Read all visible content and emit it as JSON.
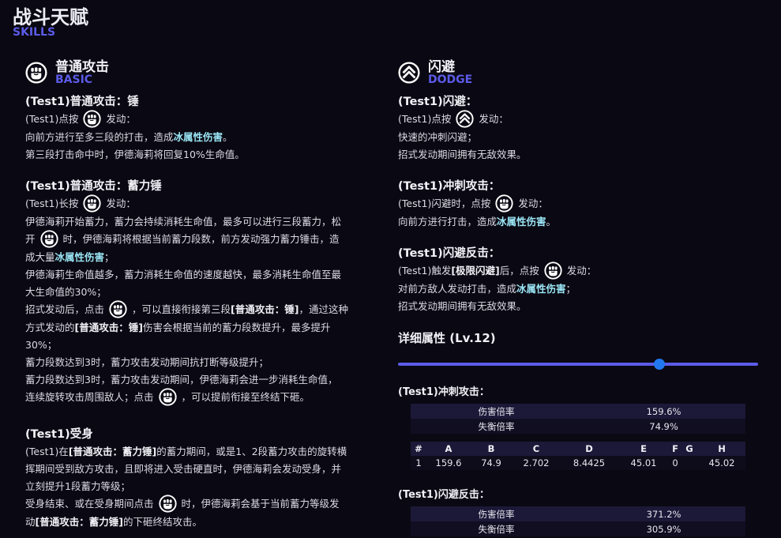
{
  "header": {
    "title": "战斗天赋",
    "subtitle": "SKILLS"
  },
  "basic": {
    "title": "普通攻击",
    "subtitle": "BASIC",
    "icon": "fist-icon",
    "b1": {
      "title": "(Test1)普通攻击：锤",
      "l1a": "(Test1)点按",
      "l1b": "发动：",
      "l2a": "向前方进行至多三段的打击，造成",
      "l2b": "冰属性伤害",
      "l2c": "。",
      "l3": "第三段打击命中时，伊德海莉将回复10%生命值。"
    },
    "b2": {
      "title": "(Test1)普通攻击：蓄力锤",
      "l1a": "(Test1)长按",
      "l1b": "发动：",
      "l2": "伊德海莉开始蓄力，蓄力会持续消耗生命值，最多可以进行三段蓄力，松",
      "l3a": "开",
      "l3b": "时，伊德海莉将根据当前蓄力段数，前方发动强力蓄力锤击，造",
      "l4a": "成大量",
      "l4b": "冰属性伤害",
      "l4c": "；",
      "l5": "伊德海莉生命值越多，蓄力消耗生命值的速度越快，最多消耗生命值至最",
      "l6": "大生命值的30%；",
      "l7a": "招式发动后，点击",
      "l7b": "，可以直接衔接第三段",
      "l7c": "[普通攻击：锤]",
      "l7d": "，通过这种",
      "l8a": "方式发动的",
      "l8b": "[普通攻击：锤]",
      "l8c": "伤害会根据当前的蓄力段数提升，最多提升",
      "l9": "30%；",
      "l10": "蓄力段数达到3时，蓄力攻击发动期间抗打断等级提升；",
      "l11": "蓄力段数达到3时，蓄力攻击发动期间，伊德海莉会进一步消耗生命值，",
      "l12a": "连续旋转攻击周围敌人；点击",
      "l12b": "，可以提前衔接至终结下砸。"
    },
    "b3": {
      "title": "(Test1)受身",
      "l1a": "(Test1)在",
      "l1b": "[普通攻击：蓄力锤]",
      "l1c": "的蓄力期间，或是1、2段蓄力攻击的旋转横",
      "l2": "挥期间受到敌方攻击，且即将进入受击硬直时，伊德海莉会发动受身，并",
      "l3": "立刻提升1段蓄力等级；",
      "l4a": "受身结束、或在受身期间点击",
      "l4b": "时，伊德海莉会基于当前蓄力等级发",
      "l5a": "动",
      "l5b": "[普通攻击：蓄力锤]",
      "l5c": "的下砸终结攻击。"
    }
  },
  "dodge": {
    "title": "闪避",
    "subtitle": "DODGE",
    "icon": "chevrons-up-icon",
    "b1": {
      "title": "(Test1)闪避：",
      "l1a": "(Test1)点按",
      "l1b": "发动：",
      "l2": "快速的冲刺闪避；",
      "l3": "招式发动期间拥有无敌效果。"
    },
    "b2": {
      "title": "(Test1)冲刺攻击：",
      "l1a": "(Test1)闪避时，点按",
      "l1b": "发动：",
      "l2a": "向前方进行打击，造成",
      "l2b": "冰属性伤害",
      "l2c": "。"
    },
    "b3": {
      "title": "(Test1)闪避反击：",
      "l1a": "(Test1)触发",
      "l1b": "[极限闪避]",
      "l1c": "后，点按",
      "l1d": "发动：",
      "l2a": "对前方敌人发动打击，造成",
      "l2b": "冰属性伤害",
      "l2c": "；",
      "l3": "招式发动期间拥有无敌效果。"
    }
  },
  "attributes": {
    "title": "详细属性 (Lv.12)",
    "level_fraction": 0.725,
    "accent": "#5b5be8",
    "knob_color": "#2278ee",
    "dash_attack": {
      "title": "(Test1)冲刺攻击：",
      "rows": [
        {
          "k": "伤害倍率",
          "v": "159.6%"
        },
        {
          "k": "失衡倍率",
          "v": "74.9%"
        }
      ],
      "headers": [
        "#",
        "A",
        "B",
        "C",
        "D",
        "E",
        "F",
        "G",
        "H"
      ],
      "values": [
        "1",
        "159.6",
        "74.9",
        "2.702",
        "8.4425",
        "45.01",
        "0",
        "",
        "45.02"
      ]
    },
    "dodge_counter": {
      "title": "(Test1)闪避反击：",
      "rows": [
        {
          "k": "伤害倍率",
          "v": "371.2%"
        },
        {
          "k": "失衡倍率",
          "v": "305.9%"
        }
      ]
    }
  }
}
